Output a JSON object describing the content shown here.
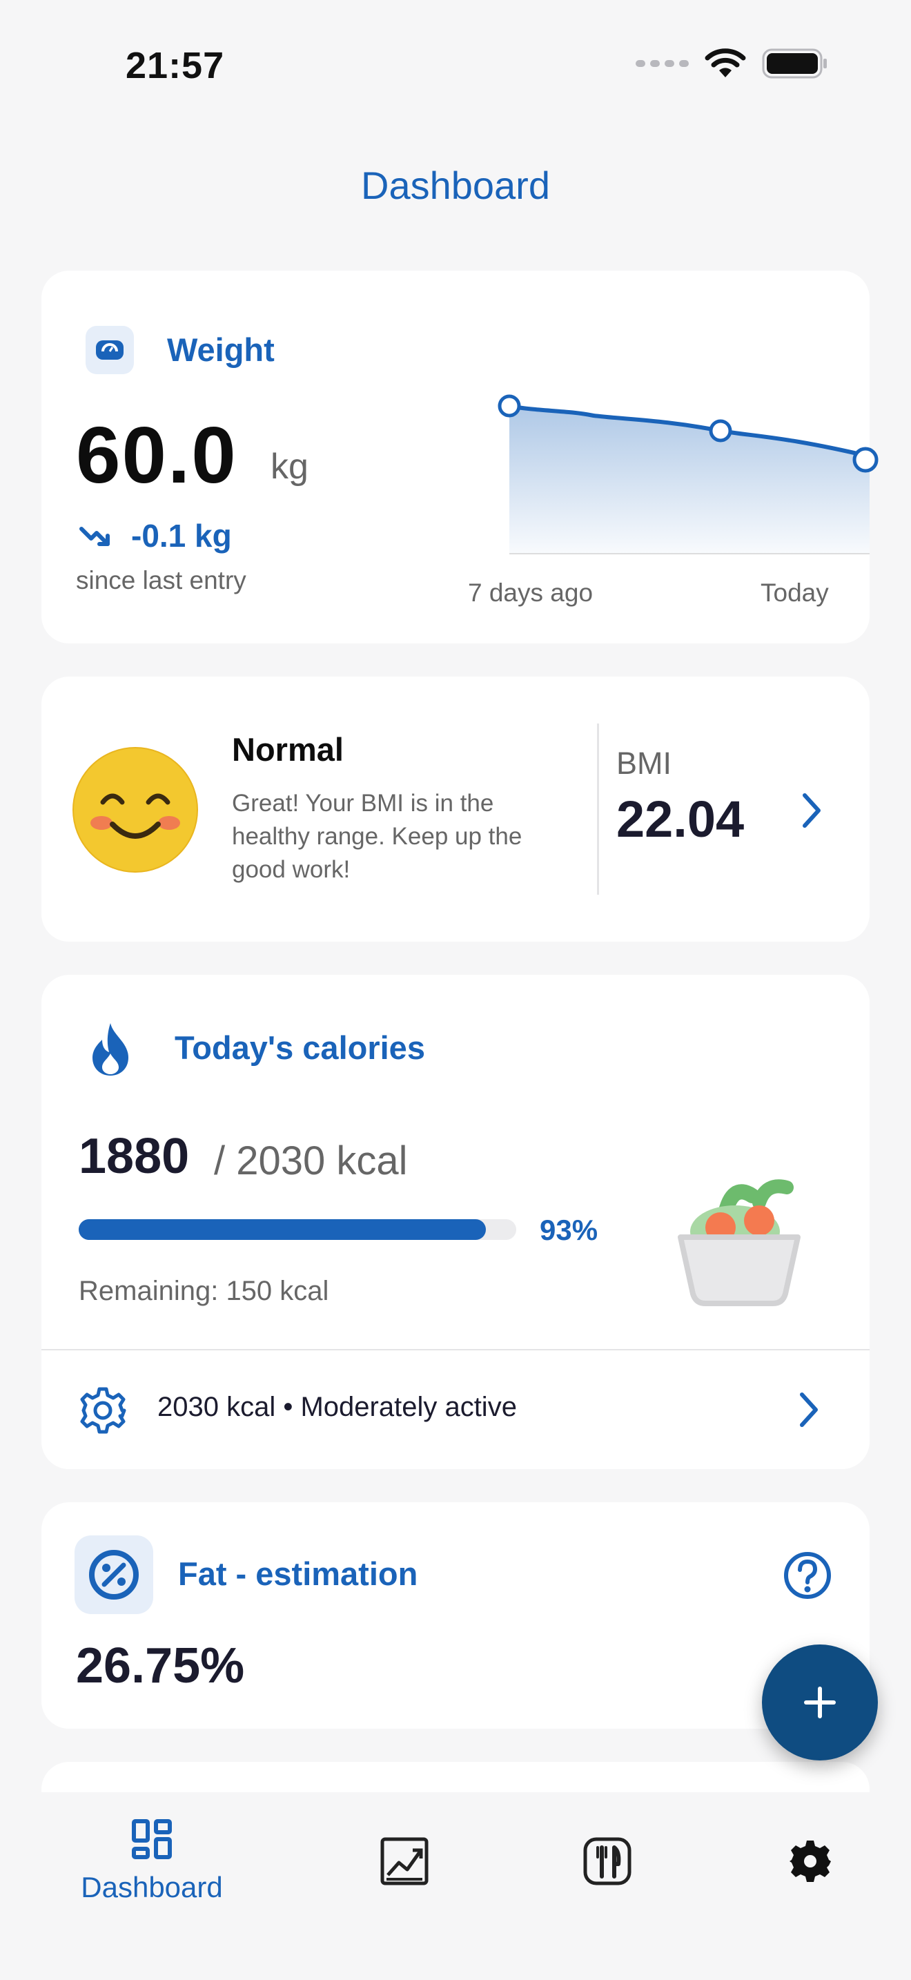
{
  "status_bar": {
    "time": "21:57"
  },
  "header": {
    "title": "Dashboard"
  },
  "weight": {
    "title": "Weight",
    "value": "60.0",
    "unit": "kg",
    "change": "-0.1 kg",
    "since": "since last entry",
    "chart_start_label": "7 days ago",
    "chart_end_label": "Today"
  },
  "bmi": {
    "status": "Normal",
    "description": "Great! Your BMI is in the healthy range. Keep up the good work!",
    "label": "BMI",
    "value": "22.04"
  },
  "calories": {
    "title": "Today's calories",
    "consumed": "1880",
    "total": "/ 2030 kcal",
    "percent_label": "93%",
    "progress": 0.93,
    "remaining": "Remaining: 150 kcal",
    "goal_text": "2030 kcal • Moderately active"
  },
  "fat": {
    "title": "Fat - estimation",
    "value": "26.75%"
  },
  "tabbar": {
    "items": [
      {
        "label": "Dashboard",
        "icon": "dashboard-icon",
        "active": true
      },
      {
        "label": "",
        "icon": "chart-icon",
        "active": false
      },
      {
        "label": "",
        "icon": "cutlery-icon",
        "active": false
      },
      {
        "label": "",
        "icon": "gear-icon",
        "active": false
      }
    ]
  },
  "colors": {
    "accent": "#1a63b9",
    "fab": "#0f4c81",
    "background": "#f6f6f7"
  }
}
